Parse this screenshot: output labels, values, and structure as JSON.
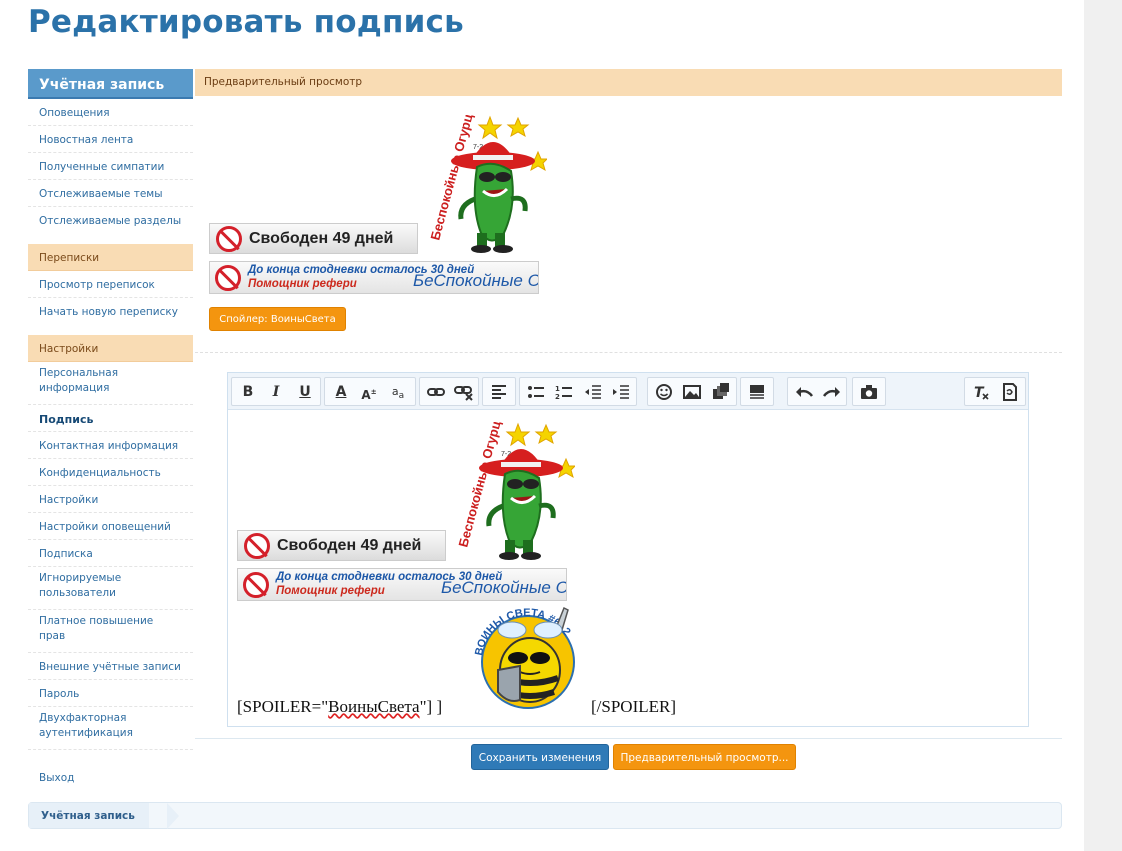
{
  "page": {
    "title": "Редактировать подпись"
  },
  "sidebar": {
    "header": "Учётная запись",
    "account_items": [
      "Оповещения",
      "Новостная лента",
      "Полученные симпатии",
      "Отслеживаемые темы",
      "Отслеживаемые разделы"
    ],
    "conversations_header": "Переписки",
    "conversations_items": [
      "Просмотр переписок",
      "Начать новую переписку"
    ],
    "settings_header": "Настройки",
    "settings_items": [
      "Персональная информация",
      "Подпись",
      "Контактная информация",
      "Конфиденциальность",
      "Настройки",
      "Настройки оповещений",
      "Подписка",
      "Игнорируемые пользователи",
      "Платное повышение прав",
      "Внешние учётные записи",
      "Пароль",
      "Двухфакторная аутентификация"
    ],
    "active_item": "Подпись",
    "logout": "Выход"
  },
  "preview": {
    "header": "Предварительный просмотр",
    "banner_days": "Свободен 49 дней",
    "banner_line1": "До конца стодневки осталось 30 дней",
    "banner_line2": "Помощник рефери",
    "banner_brand": "БеСпокойные Огур",
    "spoiler_button": "Спойлер: ВоиныСвета"
  },
  "editor": {
    "toolbar_icons": [
      "bold-icon",
      "italic-icon",
      "underline-icon",
      "font-color-icon",
      "font-size-icon",
      "font-family-icon",
      "link-icon",
      "unlink-icon",
      "align-icon",
      "bullet-list-icon",
      "numbered-list-icon",
      "outdent-icon",
      "indent-icon",
      "smilie-icon",
      "image-icon",
      "media-icon",
      "insert-template-icon",
      "undo-icon",
      "redo-icon",
      "camera-icon",
      "remove-format-icon",
      "bbcode-toggle-icon"
    ],
    "spoiler_open_prefix": "[SPOILER=\"",
    "spoiler_name": "ВоиныСвета",
    "spoiler_open_suffix": "\"] ]",
    "spoiler_close": "[/SPOILER]",
    "badge_text": "ВОИНЫ СВЕТА #6_2"
  },
  "form": {
    "save_label": "Сохранить изменения",
    "preview_label": "Предварительный просмотр..."
  },
  "breadcrumb": {
    "items": [
      "Учётная запись"
    ]
  },
  "colors": {
    "brand_blue": "#2b72a9",
    "sidebar_header": "#5a9acb",
    "orange_accent": "#f4950f",
    "section_tint": "#f9dcb4"
  }
}
